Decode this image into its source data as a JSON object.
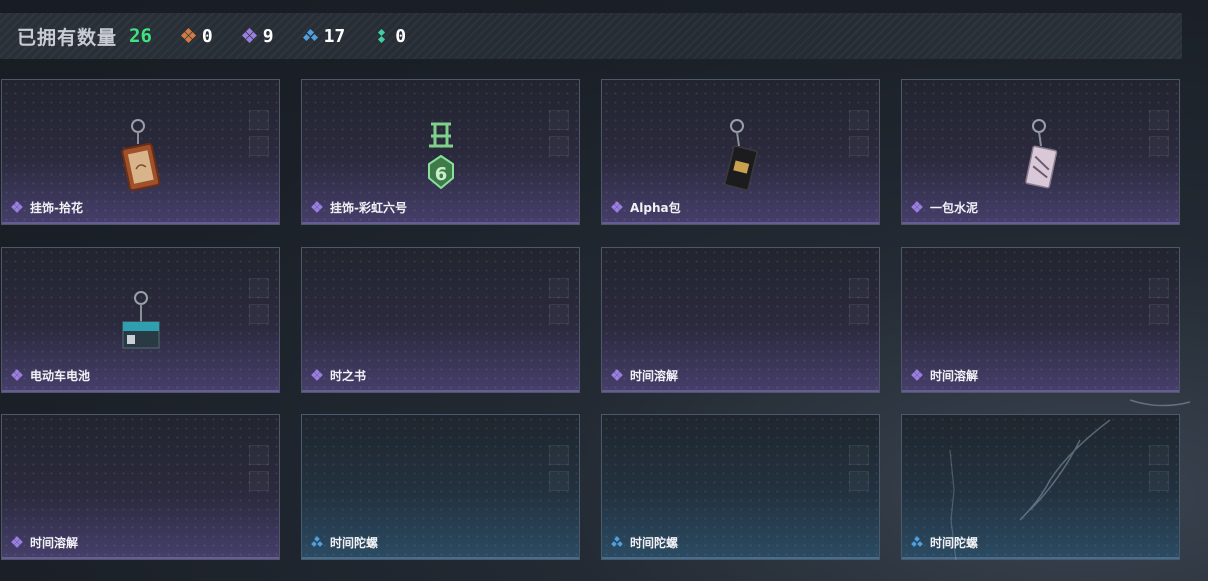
{
  "header": {
    "title": "已拥有数量",
    "total": "26",
    "stats": [
      {
        "icon": "orange-rarity-icon",
        "color": "#d07a44",
        "value": "0"
      },
      {
        "icon": "purple-rarity-icon",
        "color": "#9a7ee0",
        "value": "9"
      },
      {
        "icon": "blue-rarity-icon",
        "color": "#4fa0e0",
        "value": "17"
      },
      {
        "icon": "green-rarity-icon",
        "color": "#3ed0a0",
        "value": "0"
      }
    ]
  },
  "cards": [
    {
      "name": "挂饰-拾花",
      "rarity": "purple"
    },
    {
      "name": "挂饰-彩虹六号",
      "rarity": "purple"
    },
    {
      "name": "Alpha包",
      "rarity": "purple"
    },
    {
      "name": "一包水泥",
      "rarity": "purple"
    },
    {
      "name": "电动车电池",
      "rarity": "purple"
    },
    {
      "name": "时之书",
      "rarity": "purple"
    },
    {
      "name": "时间溶解",
      "rarity": "purple"
    },
    {
      "name": "时间溶解",
      "rarity": "purple"
    },
    {
      "name": "时间溶解",
      "rarity": "purple"
    },
    {
      "name": "时间陀螺",
      "rarity": "blue"
    },
    {
      "name": "时间陀螺",
      "rarity": "blue"
    },
    {
      "name": "时间陀螺",
      "rarity": "blue"
    }
  ]
}
